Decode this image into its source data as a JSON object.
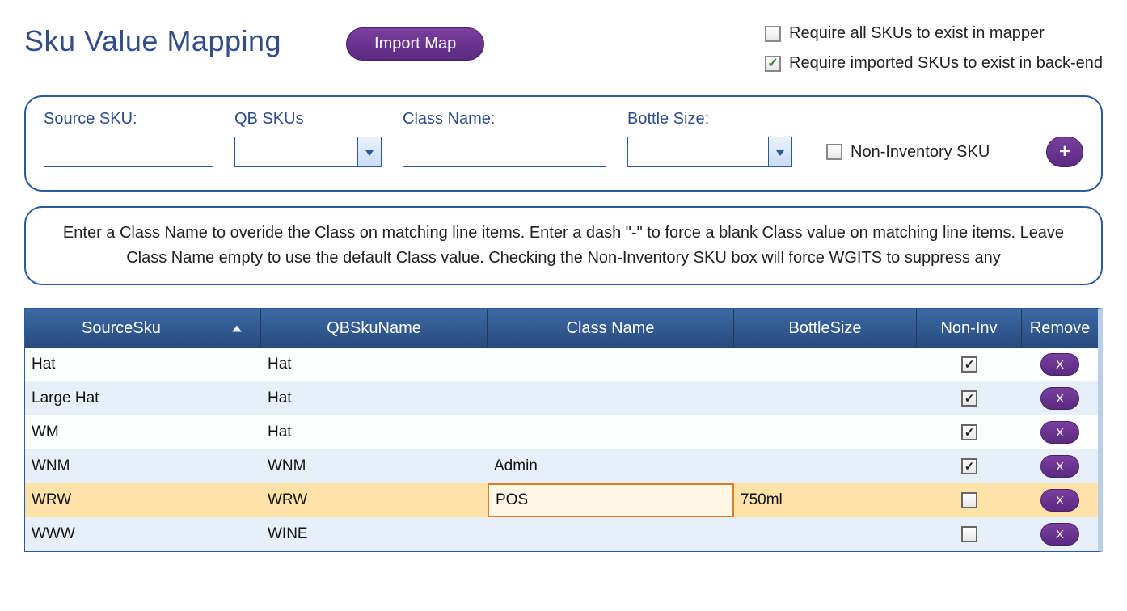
{
  "header": {
    "title": "Sku Value Mapping",
    "import_label": "Import Map"
  },
  "options": {
    "require_all": {
      "label": "Require all SKUs to exist in mapper",
      "checked": false
    },
    "require_imported": {
      "label": "Require imported SKUs to exist in back-end",
      "checked": true
    }
  },
  "form": {
    "source_sku": {
      "label": "Source SKU:",
      "value": ""
    },
    "qb_skus": {
      "label": "QB SKUs",
      "value": ""
    },
    "class_name": {
      "label": "Class Name:",
      "value": ""
    },
    "bottle_size": {
      "label": "Bottle Size:",
      "value": ""
    },
    "non_inv": {
      "label": "Non-Inventory SKU",
      "checked": false
    },
    "add_label": "+"
  },
  "help_text": "Enter a Class Name to overide the Class on matching line items. Enter a dash \"-\" to force a blank Class value on matching line items. Leave Class Name empty to use the default Class value. Checking the Non-Inventory SKU box will force WGITS to suppress any",
  "grid": {
    "columns": {
      "source": "SourceSku",
      "qb": "QBSkuName",
      "class": "Class Name",
      "bottle": "BottleSize",
      "noninv": "Non-Inv",
      "remove": "Remove"
    },
    "remove_label": "X",
    "rows": [
      {
        "source": "Hat",
        "qb": "Hat",
        "class": "",
        "bottle": "",
        "noninv": true,
        "selected": false
      },
      {
        "source": "Large Hat",
        "qb": "Hat",
        "class": "",
        "bottle": "",
        "noninv": true,
        "selected": false
      },
      {
        "source": "WM",
        "qb": "Hat",
        "class": "",
        "bottle": "",
        "noninv": true,
        "selected": false
      },
      {
        "source": "WNM",
        "qb": "WNM",
        "class": "Admin",
        "bottle": "",
        "noninv": true,
        "selected": false
      },
      {
        "source": "WRW",
        "qb": "WRW",
        "class": "POS",
        "bottle": "750ml",
        "noninv": false,
        "selected": true
      },
      {
        "source": "WWW",
        "qb": "WINE",
        "class": "",
        "bottle": "",
        "noninv": false,
        "selected": false
      }
    ]
  }
}
